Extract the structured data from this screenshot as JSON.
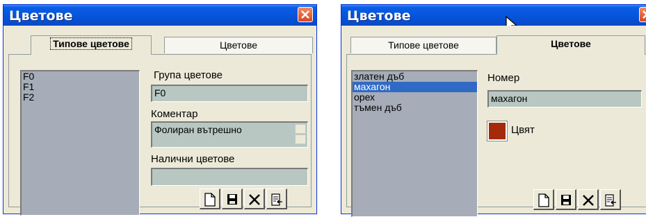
{
  "left_window": {
    "title": "Цветове",
    "tabs": [
      {
        "label": "Типове цветове",
        "active": true
      },
      {
        "label": "Цветове",
        "active": false
      }
    ],
    "list_items": [
      "F0",
      "F1",
      "F2"
    ],
    "group_label": "Група цветове",
    "group_value": "F0",
    "comment_label": "Коментар",
    "comment_value": "Фолиран вътрешно",
    "available_label": "Налични цветове",
    "available_value": "",
    "toolbar": [
      "new-icon",
      "save-icon",
      "delete-icon",
      "exit-icon"
    ]
  },
  "right_window": {
    "title": "Цветове",
    "tabs": [
      {
        "label": "Типове цветове",
        "active": false
      },
      {
        "label": "Цветове",
        "active": true
      }
    ],
    "list_items": [
      "златен дъб",
      "махагон",
      "орех",
      "тъмен дъб"
    ],
    "selected_index": 1,
    "number_label": "Номер",
    "number_value": "махагон",
    "color_label": "Цвят",
    "color_value": "#a52a0a",
    "toolbar": [
      "new-icon",
      "save-icon",
      "delete-icon",
      "exit-icon"
    ]
  }
}
